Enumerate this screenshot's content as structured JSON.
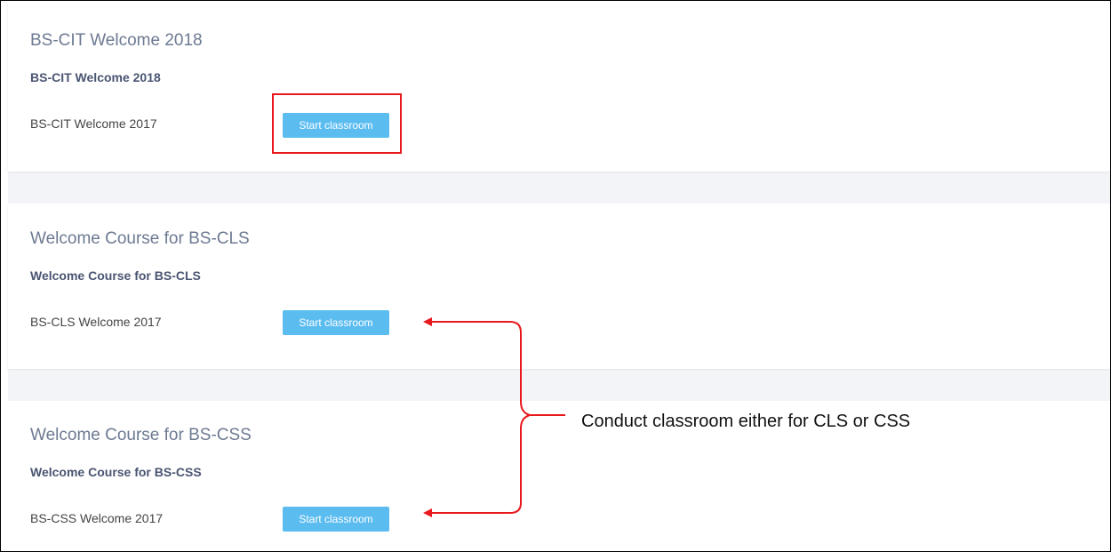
{
  "courses": [
    {
      "title": "BS-CIT Welcome 2018",
      "subtitle": "BS-CIT Welcome 2018",
      "session": "BS-CIT Welcome 2017",
      "button_label": "Start classroom"
    },
    {
      "title": "Welcome Course for BS-CLS",
      "subtitle": "Welcome Course for BS-CLS",
      "session": "BS-CLS Welcome 2017",
      "button_label": "Start classroom"
    },
    {
      "title": "Welcome Course for BS-CSS",
      "subtitle": "Welcome Course for BS-CSS",
      "session": "BS-CSS Welcome 2017",
      "button_label": "Start classroom"
    }
  ],
  "annotation": {
    "text": "Conduct classroom either for CLS or CSS",
    "color": "#e8181c"
  },
  "colors": {
    "button": "#5bbcf0",
    "title": "#6d7a92",
    "subtitle": "#4a5572",
    "section_gap": "#f3f4f7"
  }
}
